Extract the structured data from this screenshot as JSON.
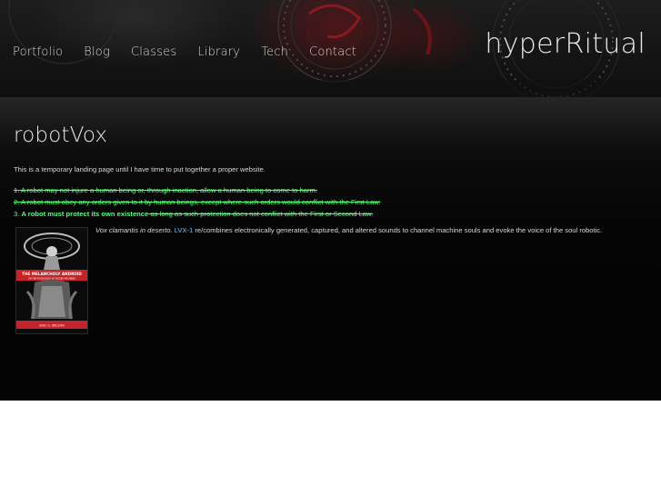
{
  "header": {
    "nav": [
      "Portfolio",
      "Blog",
      "Classes",
      "Library",
      "Tech",
      "Contact"
    ],
    "brand": "hyperRitual"
  },
  "main": {
    "title": "robotVox",
    "intro": "This is a temporary landing page until I have time to put together a proper website.",
    "laws": [
      {
        "text": "1. A robot may not injure a human being or, through inaction, allow a human being to come to harm."
      },
      {
        "text": "2. A robot must obey any orders given to it by human beings, except where such orders would conflict with the First Law."
      },
      {
        "prefix": "3. ",
        "bold": "A robot must protect its own existence",
        "strike": " as long as such protection does not conflict with the First or Second Law."
      }
    ],
    "description": {
      "latin": "Vox clamantis in deserto.",
      "lvx": "LVX-1",
      "rest": " re/combines electronically generated, captured, and altered sounds to channel machine souls and evoke the voice of the soul robotic."
    },
    "book_cover": {
      "title": "THE MELANCHOLY ANDROID",
      "subtitle": "ON THE PSYCHOLOGY OF SACRED MACHINES",
      "author": "ERIC G. WILSON"
    }
  },
  "colors": {
    "law_green": "#5dff7a",
    "link_blue": "#6fc8ff",
    "cover_red": "#c2242a"
  }
}
